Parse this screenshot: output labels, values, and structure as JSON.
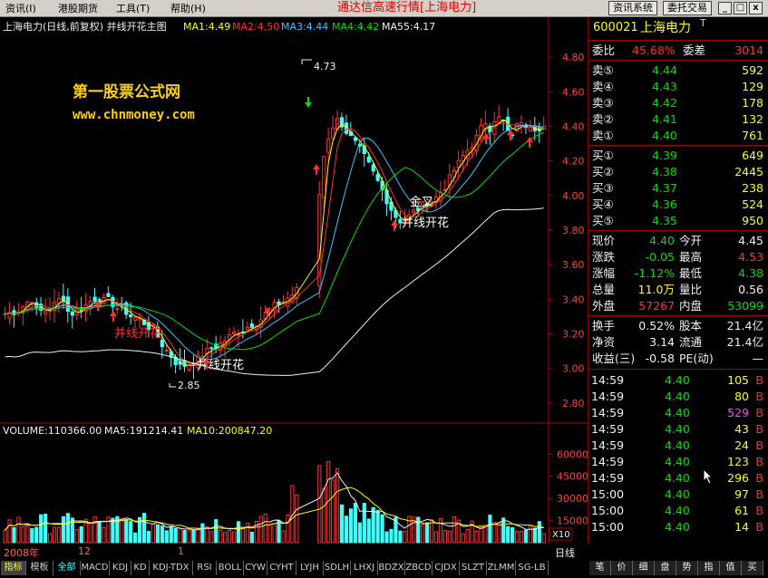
{
  "menu": {
    "items": [
      "资讯(I)",
      "港股期货",
      "工具(T)",
      "帮助(H)"
    ],
    "app_title": "通达信高速行情[上海电力]",
    "buttons": [
      "资讯系统",
      "委托交易"
    ],
    "window_controls": [
      "_",
      "□",
      "x"
    ]
  },
  "main_chart": {
    "header": "上海电力(日线,前复权) 并线开花主图",
    "ma": [
      {
        "label": "MA1:4.49",
        "color": "#ffff00"
      },
      {
        "label": "MA2:4.50",
        "color": "#ff3030"
      },
      {
        "label": "MA3:4.44",
        "color": "#40c0ff"
      },
      {
        "label": "MA4:4.42",
        "color": "#00e000"
      },
      {
        "label": "MA55:4.17",
        "color": "#f0f0f0"
      }
    ],
    "watermark_title": "第一股票公式网",
    "watermark_url": "www.chnmoney.com",
    "annotations": {
      "high": "4.73",
      "low": "2.85",
      "golden_cross": "金叉",
      "flower_1": "并线开花",
      "flower_2": "并线开花",
      "flower_3": "并线开花"
    },
    "y_ticks": [
      "4.80",
      "4.60",
      "4.40",
      "4.20",
      "4.00",
      "3.80",
      "3.60",
      "3.40",
      "3.20",
      "3.00",
      "2.80"
    ]
  },
  "volume_chart": {
    "header_volume": "VOLUME:110366.00",
    "header_ma5": "MA5:191214.41",
    "header_ma10": "MA10:200847.20",
    "y_ticks": [
      "60000",
      "45000",
      "30000",
      "15000"
    ],
    "unit": "X10"
  },
  "date_axis": {
    "labels": [
      "2008年",
      "12",
      "1"
    ],
    "period": "日线"
  },
  "quote": {
    "code": "600021",
    "name": "上海电力",
    "name_suffix": "T",
    "committee_ratio_label": "委比",
    "committee_ratio": "45.68%",
    "committee_diff_label": "委差",
    "committee_diff": "3014",
    "sell": [
      {
        "label": "卖⑤",
        "price": "4.44",
        "vol": "592"
      },
      {
        "label": "卖④",
        "price": "4.43",
        "vol": "129"
      },
      {
        "label": "卖③",
        "price": "4.42",
        "vol": "178"
      },
      {
        "label": "卖②",
        "price": "4.41",
        "vol": "132"
      },
      {
        "label": "卖①",
        "price": "4.40",
        "vol": "761"
      }
    ],
    "buy": [
      {
        "label": "买①",
        "price": "4.39",
        "vol": "649"
      },
      {
        "label": "买②",
        "price": "4.38",
        "vol": "2445"
      },
      {
        "label": "买③",
        "price": "4.37",
        "vol": "238"
      },
      {
        "label": "买④",
        "price": "4.36",
        "vol": "524"
      },
      {
        "label": "买⑤",
        "price": "4.35",
        "vol": "950"
      }
    ],
    "stats": [
      {
        "l1": "现价",
        "v1": "4.40",
        "c1": "grn",
        "l2": "今开",
        "v2": "4.45",
        "c2": "wht"
      },
      {
        "l1": "涨跌",
        "v1": "-0.05",
        "c1": "grn",
        "l2": "最高",
        "v2": "4.53",
        "c2": "red"
      },
      {
        "l1": "涨幅",
        "v1": "-1.12%",
        "c1": "grn",
        "l2": "最低",
        "v2": "4.38",
        "c2": "grn"
      },
      {
        "l1": "总量",
        "v1": "11.0万",
        "c1": "yel",
        "l2": "量比",
        "v2": "0.56",
        "c2": "wht"
      },
      {
        "l1": "外盘",
        "v1": "57267",
        "c1": "red",
        "l2": "内盘",
        "v2": "53099",
        "c2": "grn"
      }
    ],
    "fund": [
      {
        "l1": "换手",
        "v1": "0.52%",
        "l2": "股本",
        "v2": "21.4亿"
      },
      {
        "l1": "净资",
        "v1": "3.14",
        "l2": "流通",
        "v2": "21.4亿"
      },
      {
        "l1": "收益(三)",
        "v1": "-0.58",
        "l2": "PE(动)",
        "v2": "—"
      }
    ],
    "ticks": [
      {
        "time": "14:59",
        "price": "4.40",
        "vol": "105",
        "side": "B",
        "vc": "yel"
      },
      {
        "time": "14:59",
        "price": "4.40",
        "vol": "80",
        "side": "B",
        "vc": "yel"
      },
      {
        "time": "14:59",
        "price": "4.40",
        "vol": "529",
        "side": "B",
        "vc": "mag"
      },
      {
        "time": "14:59",
        "price": "4.40",
        "vol": "43",
        "side": "B",
        "vc": "yel"
      },
      {
        "time": "14:59",
        "price": "4.40",
        "vol": "24",
        "side": "B",
        "vc": "yel"
      },
      {
        "time": "14:59",
        "price": "4.40",
        "vol": "123",
        "side": "B",
        "vc": "yel"
      },
      {
        "time": "14:59",
        "price": "4.40",
        "vol": "296",
        "side": "B",
        "vc": "yel"
      },
      {
        "time": "15:00",
        "price": "4.40",
        "vol": "97",
        "side": "B",
        "vc": "yel"
      },
      {
        "time": "15:00",
        "price": "4.40",
        "vol": "61",
        "side": "B",
        "vc": "yel"
      },
      {
        "time": "15:00",
        "price": "4.40",
        "vol": "14",
        "side": "B",
        "vc": "yel"
      }
    ]
  },
  "tabs": [
    "指标",
    "模板",
    "全部",
    "MACD",
    "KDJ",
    "KD",
    "KDJ-TDX",
    "RSI",
    "BOLL",
    "CYW",
    "CYHT",
    "LYJH",
    "SDLH",
    "LHXJ",
    "BDZX",
    "ZBCD",
    "CJDX",
    "SLZT",
    "ZLMM",
    "SG-LB"
  ],
  "right_tabs": [
    "笔",
    "价",
    "细",
    "盘",
    "势",
    "指",
    "值",
    "买"
  ],
  "colors": {
    "up": "#ff3030",
    "down": "#40ffff",
    "axis": "#b00000",
    "bg": "#000000"
  }
}
